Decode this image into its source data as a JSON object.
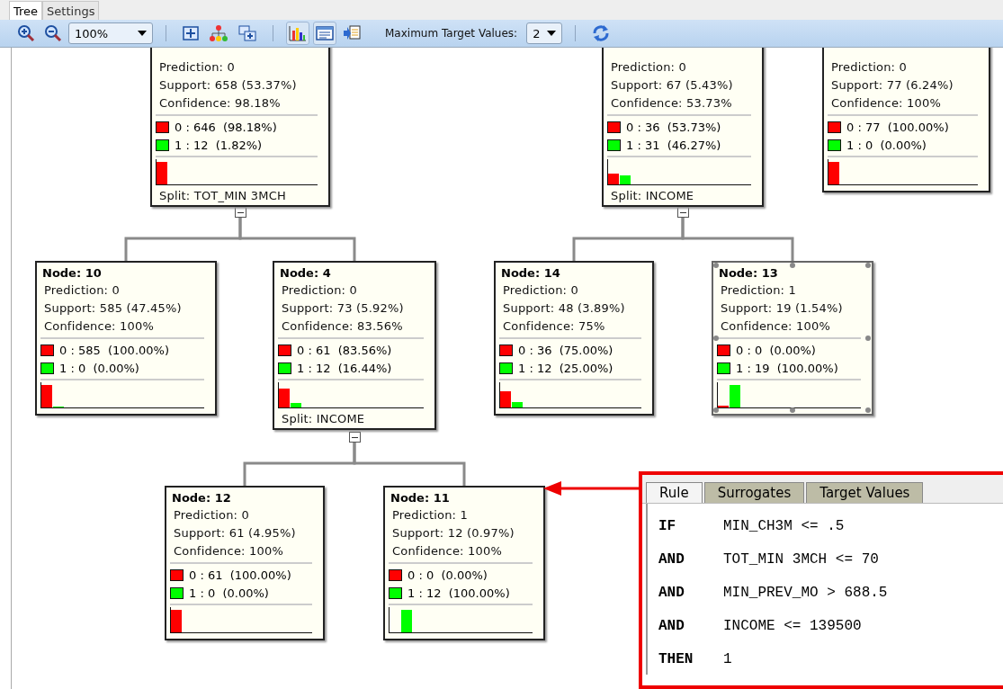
{
  "tabs": [
    {
      "label": "Tree",
      "selected": true
    },
    {
      "label": "Settings",
      "selected": false
    }
  ],
  "toolbar": {
    "items": [
      {
        "kind": "zoom-in"
      },
      {
        "kind": "zoom-out"
      },
      {
        "kind": "select",
        "value": "100%"
      },
      {
        "kind": "separator"
      },
      {
        "kind": "fit"
      },
      {
        "kind": "layout"
      },
      {
        "kind": "expand"
      },
      {
        "kind": "separator"
      },
      {
        "kind": "chart",
        "pressed": true
      },
      {
        "kind": "detail",
        "pressed": true
      },
      {
        "kind": "export",
        "pressed": false
      },
      {
        "kind": "label",
        "text": "Maximum Target Values:"
      },
      {
        "kind": "select",
        "value": "2"
      },
      {
        "kind": "separator"
      },
      {
        "kind": "refresh"
      }
    ]
  },
  "tree": [
    {
      "prediction": "Prediction: 0",
      "support": "Support: 658 (53.37%)",
      "confidence": "Confidence: 98.18%",
      "selected": false,
      "expanded": true,
      "classes": [
        {
          "text": "0 : 646  (98.18%)",
          "color": "#ff0000"
        },
        {
          "text": "1 : 12  (1.82%)",
          "color": "#00ff00"
        }
      ],
      "split": "Split: TOT_MIN 3MCH",
      "children": [
        {
          "title": "Node: 10",
          "prediction": "Prediction: 0",
          "support": "Support: 585 (47.45%)",
          "confidence": "Confidence: 100%",
          "selected": false,
          "classes": [
            {
              "text": "0 : 585  (100.00%)",
              "color": "#ff0000"
            },
            {
              "text": "1 : 0  (0.00%)",
              "color": "#00ff00"
            }
          ]
        },
        {
          "title": "Node: 4",
          "prediction": "Prediction: 0",
          "support": "Support: 73 (5.92%)",
          "confidence": "Confidence: 83.56%",
          "selected": false,
          "expanded": true,
          "classes": [
            {
              "text": "0 : 61  (83.56%)",
              "color": "#ff0000"
            },
            {
              "text": "1 : 12  (16.44%)",
              "color": "#00ff00"
            }
          ],
          "split": "Split: INCOME",
          "children": [
            {
              "title": "Node: 12",
              "prediction": "Prediction: 0",
              "support": "Support: 61 (4.95%)",
              "confidence": "Confidence: 100%",
              "selected": false,
              "classes": [
                {
                  "text": "0 : 61  (100.00%)",
                  "color": "#ff0000"
                },
                {
                  "text": "1 : 0  (0.00%)",
                  "color": "#00ff00"
                }
              ]
            },
            {
              "title": "Node: 11",
              "prediction": "Prediction: 1",
              "support": "Support: 12 (0.97%)",
              "confidence": "Confidence: 100%",
              "selected": false,
              "classes": [
                {
                  "text": "0 : 0  (0.00%)",
                  "color": "#ff0000"
                },
                {
                  "text": "1 : 12  (100.00%)",
                  "color": "#00ff00"
                }
              ]
            }
          ]
        }
      ]
    },
    {
      "prediction": "Prediction: 0",
      "support": "Support: 67 (5.43%)",
      "confidence": "Confidence: 53.73%",
      "selected": false,
      "expanded": true,
      "classes": [
        {
          "text": "0 : 36  (53.73%)",
          "color": "#ff0000"
        },
        {
          "text": "1 : 31  (46.27%)",
          "color": "#00ff00"
        }
      ],
      "split": "Split: INCOME",
      "children": [
        {
          "title": "Node: 14",
          "prediction": "Prediction: 0",
          "support": "Support: 48 (3.89%)",
          "confidence": "Confidence: 75%",
          "selected": false,
          "classes": [
            {
              "text": "0 : 36  (75.00%)",
              "color": "#ff0000"
            },
            {
              "text": "1 : 12  (25.00%)",
              "color": "#00ff00"
            }
          ]
        },
        {
          "title": "Node: 13",
          "prediction": "Prediction: 1",
          "support": "Support: 19 (1.54%)",
          "confidence": "Confidence: 100%",
          "selected": true,
          "classes": [
            {
              "text": "0 : 0  (0.00%)",
              "color": "#ff0000"
            },
            {
              "text": "1 : 19  (100.00%)",
              "color": "#00ff00"
            }
          ]
        }
      ]
    },
    {
      "prediction": "Prediction: 0",
      "support": "Support: 77 (6.24%)",
      "confidence": "Confidence: 100%",
      "selected": false,
      "classes": [
        {
          "text": "0 : 77  (100.00%)",
          "color": "#ff0000"
        },
        {
          "text": "1 : 0  (0.00%)",
          "color": "#00ff00"
        }
      ]
    }
  ],
  "rule_panel": {
    "tabs": [
      {
        "label": "Rule",
        "selected": true
      },
      {
        "label": "Surrogates",
        "selected": false
      },
      {
        "label": "Target Values",
        "selected": false
      }
    ],
    "lines": [
      {
        "keyword": "IF",
        "text": "MIN_CH3M <= .5"
      },
      {
        "keyword": "AND",
        "text": "TOT_MIN 3MCH <= 70"
      },
      {
        "keyword": "AND",
        "text": "MIN_PREV_MO > 688.5"
      },
      {
        "keyword": "AND",
        "text": "INCOME <= 139500"
      },
      {
        "keyword": "THEN",
        "text": "1"
      }
    ]
  }
}
